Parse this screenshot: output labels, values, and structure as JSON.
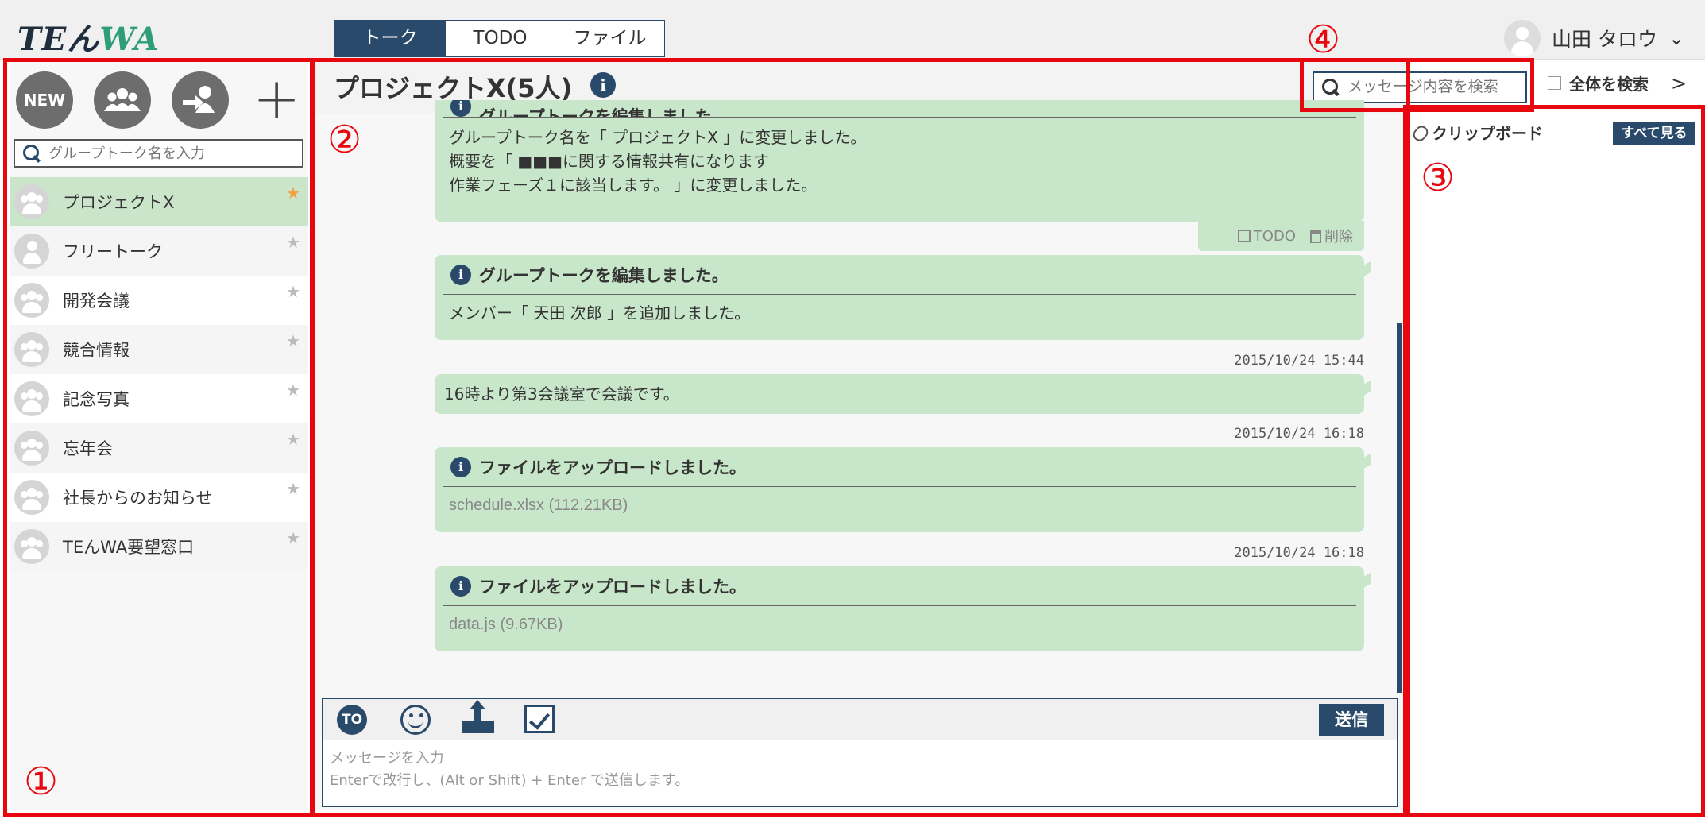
{
  "header": {
    "logo_part1": "TEん",
    "logo_part2": "WA",
    "tabs": [
      {
        "label": "トーク",
        "active": true
      },
      {
        "label": "TODO",
        "active": false
      },
      {
        "label": "ファイル",
        "active": false
      }
    ],
    "user_name": "山田 タロウ",
    "user_caret": "⌄"
  },
  "annotations": [
    "①",
    "②",
    "③",
    "④"
  ],
  "sidebar": {
    "new_label": "NEW",
    "plus_label": "+",
    "search_placeholder": "グループトーク名を入力",
    "groups": [
      {
        "name": "プロジェクトX",
        "starred": true,
        "active": true
      },
      {
        "name": "フリートーク",
        "starred": false,
        "active": false
      },
      {
        "name": "開発会議",
        "starred": false,
        "active": false
      },
      {
        "name": "競合情報",
        "starred": false,
        "active": false
      },
      {
        "name": "記念写真",
        "starred": false,
        "active": false
      },
      {
        "name": "忘年会",
        "starred": false,
        "active": false
      },
      {
        "name": "社長からのお知らせ",
        "starred": false,
        "active": false
      },
      {
        "name": "TEんWA要望窓口",
        "starred": false,
        "active": false
      }
    ],
    "star_glyph": "★"
  },
  "chat": {
    "title": "プロジェクトX(5人)",
    "info_glyph": "i",
    "search_placeholder": "メッセージ内容を検索",
    "global_search_label": "全体を検索",
    "global_search_chevron": ">",
    "messages": [
      {
        "type": "system",
        "header": "グループトークを編集しました。",
        "lines": [
          "グループトーク名を「 プロジェクトX 」に変更しました。",
          "概要を「 ■■■に関する情報共有になります",
          "作業フェーズ１に該当します。 」に変更しました。"
        ]
      },
      {
        "type": "system",
        "header": "グループトークを編集しました。",
        "lines": [
          "メンバー「 天田 次郎 」を追加しました。"
        ]
      },
      {
        "type": "text",
        "timestamp": "2015/10/24 15:44",
        "text": "16時より第3会議室で会議です。"
      },
      {
        "type": "file",
        "timestamp": "2015/10/24 16:18",
        "header": "ファイルをアップロードしました。",
        "file": "schedule.xlsx (112.21KB)"
      },
      {
        "type": "file",
        "timestamp": "2015/10/24 16:18",
        "header": "ファイルをアップロードしました。",
        "file": "data.js (9.67KB)"
      }
    ],
    "actions": {
      "todo": "TODO",
      "delete": "削除"
    }
  },
  "composer": {
    "to_label": "TO",
    "send_label": "送信",
    "placeholder_line1": "メッセージを入力",
    "placeholder_line2": "Enterで改行し、(Alt or Shift) + Enter で送信します。"
  },
  "clipboard": {
    "label": "クリップボード",
    "see_all": "すべて見る"
  },
  "colors": {
    "primary": "#2a4a6b",
    "bubble": "#c8e6c9",
    "annotation_red": "#e8070f",
    "star_on": "#f4a040"
  }
}
